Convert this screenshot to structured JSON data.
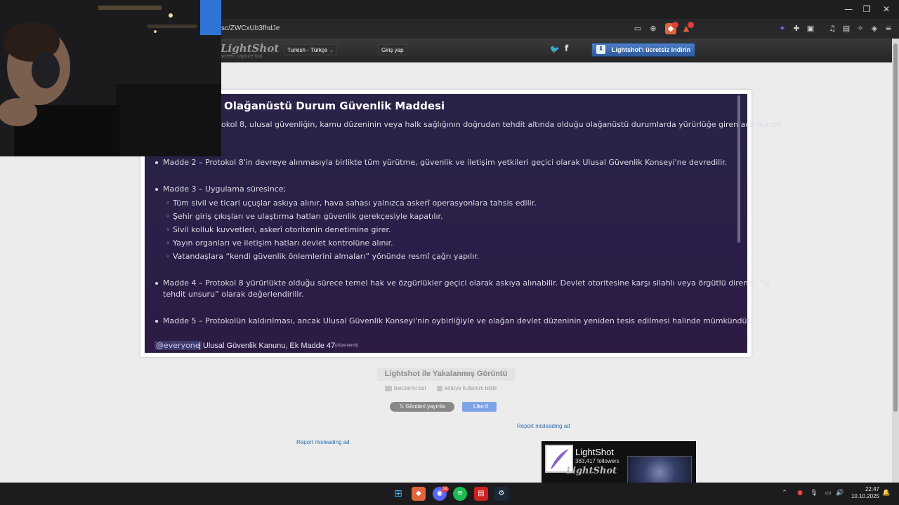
{
  "browser": {
    "url": "sc/ZWCxUb3fhdJe",
    "window_controls": [
      "—",
      "❐",
      "✕"
    ]
  },
  "lightshot_header": {
    "logo": "LightShot",
    "logo_sub": "screen capture tool",
    "language": "Turkish - Türkçe",
    "login": "Giriş yap",
    "download": "Lightshot'ı ücretsiz indirin"
  },
  "screenshot": {
    "title": "Olağanüstü Durum Güvenlik Maddesi",
    "intro": "okol 8, ulusal güvenliğin, kamu düzeninin veya halk sağlığının doğrudan tehdit altında olduğu olağanüstü durumlarda yürürlüğe giren acil durum",
    "madde2": "Madde 2 – Protokol 8'in devreye alınmasıyla birlikte tüm yürütme, güvenlik ve iletişim yetkileri geçici olarak Ulusal Güvenlik Konseyi'ne devredilir.",
    "madde3": "Madde 3 – Uygulama süresince;",
    "madde3_items": [
      "Tüm sivil ve ticari uçuşlar askıya alınır, hava sahası yalnızca askerî operasyonlara tahsis edilir.",
      "Şehir giriş çıkışları ve ulaştırma hatları güvenlik gerekçesiyle kapatılır.",
      "Sivil kolluk kuvvetleri, askerî otoritenin denetimine girer.",
      "Yayın organları ve iletişim hatları devlet kontrolüne alınır.",
      "Vatandaşlara “kendi güvenlik önlemlerini almaları” yönünde resmî çağrı yapılır."
    ],
    "madde4_line1": "Madde 4 – Protokol 8 yürürlükte olduğu sürece temel hak ve özgürlükler geçici olarak askıya alınabilir. Devlet otoritesine karşı silahlı veya örgütlü direniş, “iç",
    "madde4_line2": "tehdit unsuru” olarak değerlendirilir.",
    "madde5": "Madde 5 – Protokolün kaldırılması, ancak Ulusal Güvenlik Konseyi'nin oybirliğiyle ve olağan devlet düzeninin yeniden tesis edilmesi halinde mümkündür.",
    "mention": "@everyone",
    "footer": "| Ulusal Güvenlik Kanunu, Ek Madde 47",
    "edited": "(düzenlendi)"
  },
  "below": {
    "caption": "Lightshot ile Yakalanmış Görüntü",
    "similar": "benzerini bul",
    "report_abuse": "kötüye kullanım bildir",
    "tweet": "Gönderi yayınla",
    "like": "Like 0",
    "report_ad": "Report misleading ad"
  },
  "ad": {
    "name": "LightShot",
    "followers": "383,417 followers"
  },
  "taskbar": {
    "time": "22:47",
    "date": "10.10.2025",
    "discord_badge": "24"
  },
  "icons": [
    "cast-icon",
    "zoom-icon",
    "brave-shield-icon",
    "brave-rewards-icon",
    "extension-icon",
    "puzzle-icon",
    "sidebar-icon",
    "music-icon",
    "wallet-icon",
    "leo-icon",
    "vpn-icon",
    "menu-icon",
    "twitter-icon",
    "facebook-icon",
    "windows-icon",
    "brave-icon",
    "discord-icon",
    "spotify-icon",
    "news-icon",
    "steam-icon"
  ]
}
